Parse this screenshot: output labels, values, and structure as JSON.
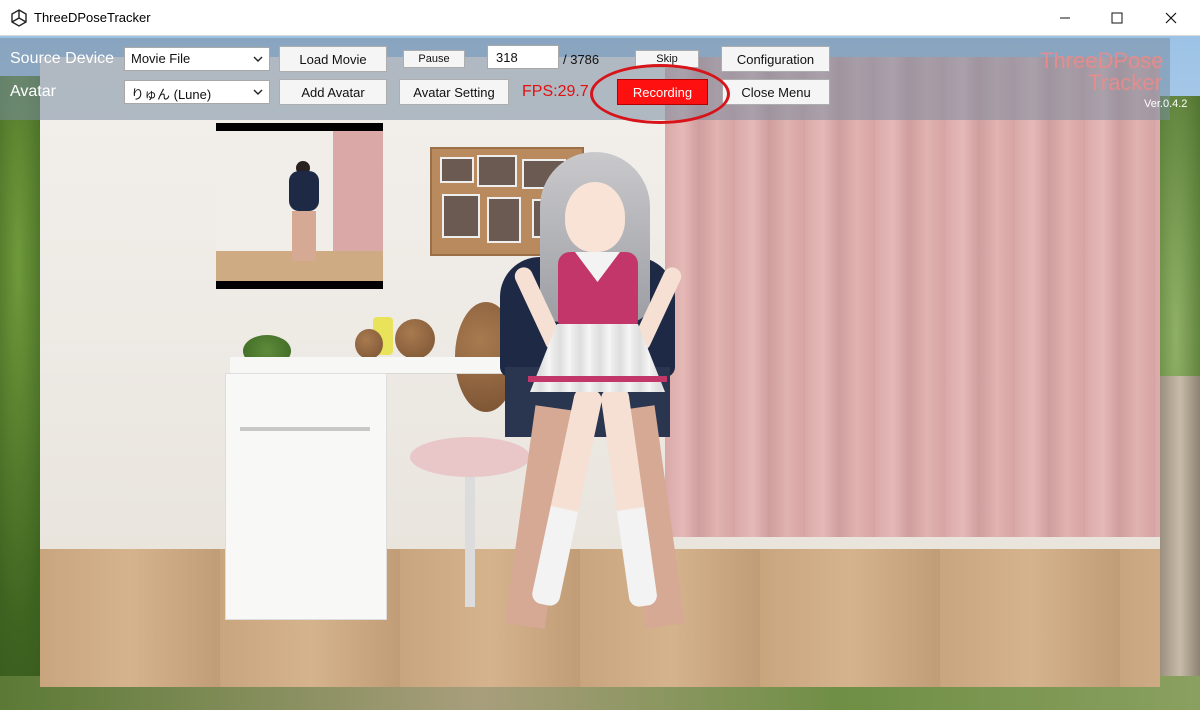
{
  "window": {
    "title": "ThreeDPoseTracker"
  },
  "controls": {
    "source_device_label": "Source Device",
    "source_device_value": "Movie File",
    "load_movie_label": "Load Movie",
    "pause_label": "Pause",
    "frame_current": "318",
    "frame_total": "/ 3786",
    "skip_label": "Skip",
    "configuration_label": "Configuration",
    "avatar_label": "Avatar",
    "avatar_value": "りゅん (Lune)",
    "add_avatar_label": "Add Avatar",
    "avatar_setting_label": "Avatar Setting",
    "fps": "FPS:29.7",
    "recording_label": "Recording",
    "close_menu_label": "Close Menu"
  },
  "brand": {
    "line1": "ThreeDPose",
    "line2": "Tracker",
    "version": "Ver.0.4.2"
  },
  "colors": {
    "recording": "#ff1010",
    "fps": "#e01010",
    "highlight": "#d6141a"
  },
  "icons": {
    "app": "unity-logo-icon",
    "minimize": "minimize-icon",
    "maximize": "maximize-icon",
    "close": "close-icon",
    "dropdown": "chevron-down-icon"
  }
}
